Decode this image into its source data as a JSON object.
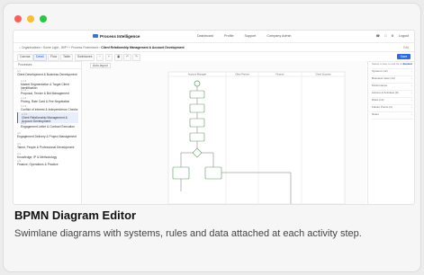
{
  "app": {
    "brand": "Process Intelligence",
    "nav": [
      "Dashboard",
      "Profile",
      "Support",
      "Company Admin"
    ],
    "nav_right": [
      "Logout"
    ]
  },
  "breadcrumb": {
    "path": "Organisations  ›  Some Light - 80P+  ›  Process Framework  › ",
    "current": "Client Relationship Management & Account Development",
    "right": "Edit"
  },
  "toolbar": {
    "buttons": [
      "Canvas",
      "Detail",
      "Flow",
      "Table",
      "Swimlanes"
    ],
    "active_index": 1,
    "save": "Save"
  },
  "sidebar": {
    "header": "Processes",
    "items": [
      {
        "code": "4.1",
        "label": "Client Development & Business Development"
      },
      {
        "code": "4.1.1",
        "label": "Market Segmentation & Target Client Identification"
      },
      {
        "code": "4.1.2",
        "label": "Proposal, Tender & Bid Management"
      },
      {
        "code": "4.1.3",
        "label": "Pricing, Rate Card & Fee Negotiation"
      },
      {
        "code": "4.1.4",
        "label": "Conflict of Interest & Independence Checks"
      },
      {
        "code": "4.1.5",
        "label": "Client Relationship Management & Account Development"
      },
      {
        "code": "4.1.6",
        "label": "Engagement Letter & Contract Execution"
      },
      {
        "code": "4.2",
        "label": "Engagement Delivery & Project Management"
      },
      {
        "code": "4.3",
        "label": "Talent, People & Professional Development"
      },
      {
        "code": "4.4",
        "label": "Knowledge, IP & Methodology"
      },
      {
        "code": "4.5",
        "label": "Finance, Operations & Practice"
      }
    ],
    "selected_index": 5
  },
  "canvas": {
    "auto_layout": "Auto-layout",
    "lanes": [
      "Account Manager",
      "Client Partner",
      "Finance",
      "Client Success"
    ]
  },
  "right_panel": {
    "header": "Select a step to edit its properties",
    "header_action": "Expand",
    "rows": [
      "Systems (12)",
      "Business rules (14)",
      "Performance",
      "Actions & Activities (8)",
      "Risks (12)",
      "Failure Points (3)",
      "Notes"
    ]
  },
  "caption": {
    "title": "BPMN Diagram Editor",
    "description": "Swimlane diagrams with systems, rules and data attached at each activity step."
  },
  "colors": {
    "accent": "#2b6be6",
    "node_stroke": "#5a9a5a",
    "window_red": "#ff5f57",
    "window_yellow": "#febc2e",
    "window_green": "#28c840"
  }
}
